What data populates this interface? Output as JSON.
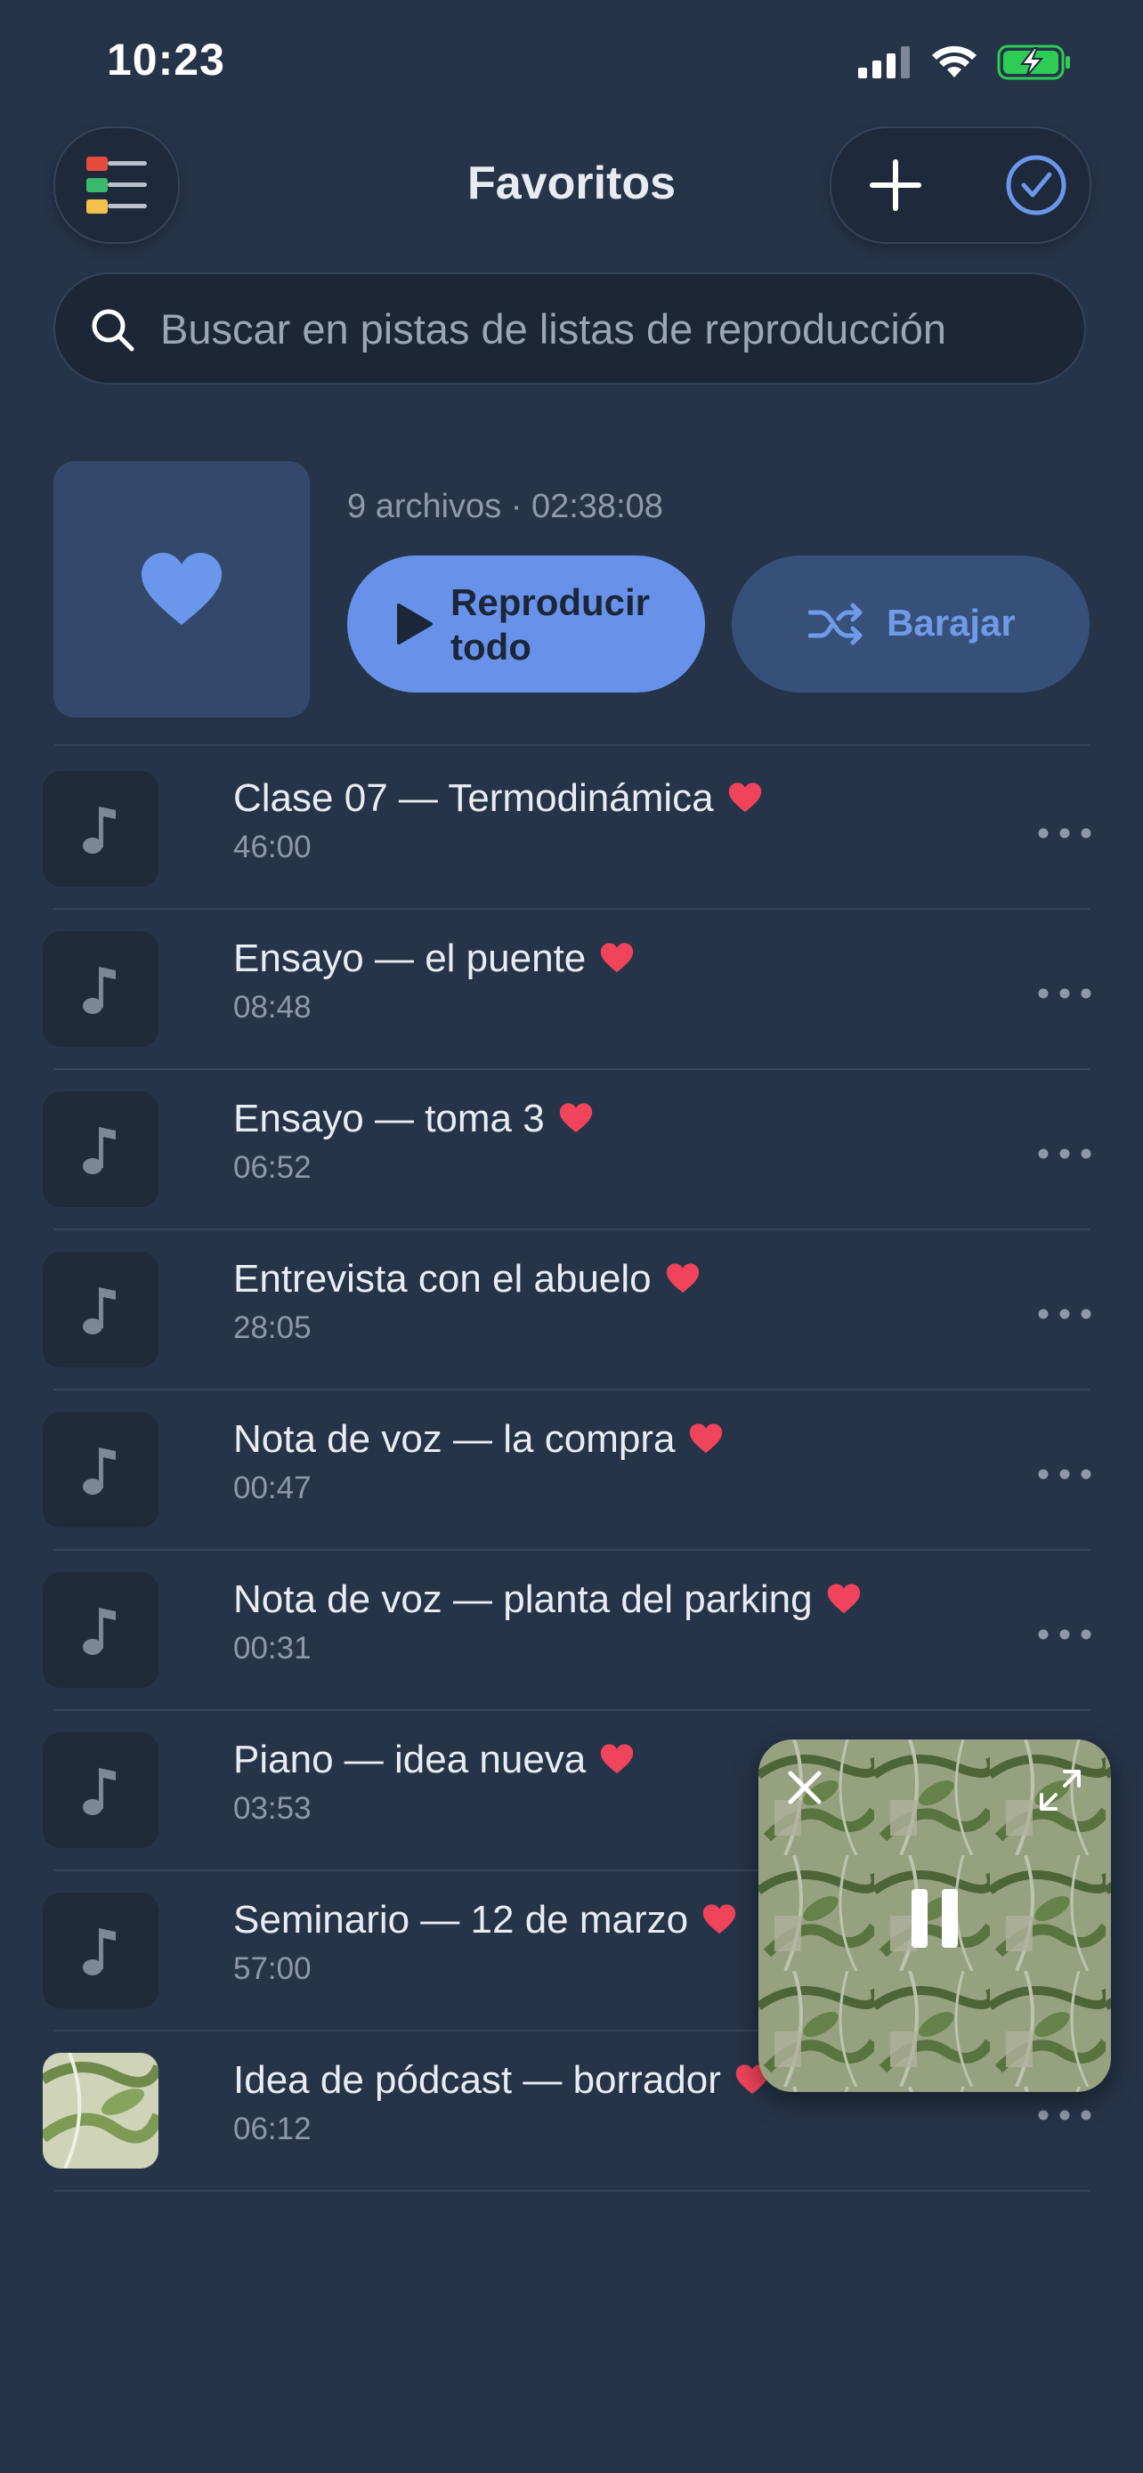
{
  "status_bar": {
    "time": "10:23"
  },
  "header": {
    "title": "Favoritos",
    "menu_icon": "playlist-menu-icon",
    "add_icon": "plus-icon",
    "select_icon": "checkmark-circle-icon"
  },
  "search": {
    "placeholder": "Buscar en pistas de listas de reproducción"
  },
  "playlist": {
    "meta": "9 archivos · 02:38:08",
    "play_all_label": "Reproducir todo",
    "shuffle_label": "Barajar"
  },
  "tracks": [
    {
      "title": "Clase 07 — Termodinámica",
      "duration": "46:00"
    },
    {
      "title": "Ensayo — el puente",
      "duration": "08:48"
    },
    {
      "title": "Ensayo — toma 3",
      "duration": "06:52"
    },
    {
      "title": "Entrevista con el abuelo",
      "duration": "28:05"
    },
    {
      "title": "Nota de voz — la compra",
      "duration": "00:47"
    },
    {
      "title": "Nota de voz — planta del parking",
      "duration": "00:31"
    },
    {
      "title": "Piano — idea nueva",
      "duration": "03:53"
    },
    {
      "title": "Seminario — 12 de marzo",
      "duration": "57:00"
    },
    {
      "title": "Idea de pódcast — borrador",
      "duration": "06:12"
    }
  ],
  "colors": {
    "background": "#26344a",
    "accent": "#6892ea",
    "heart": "#f0435c"
  }
}
